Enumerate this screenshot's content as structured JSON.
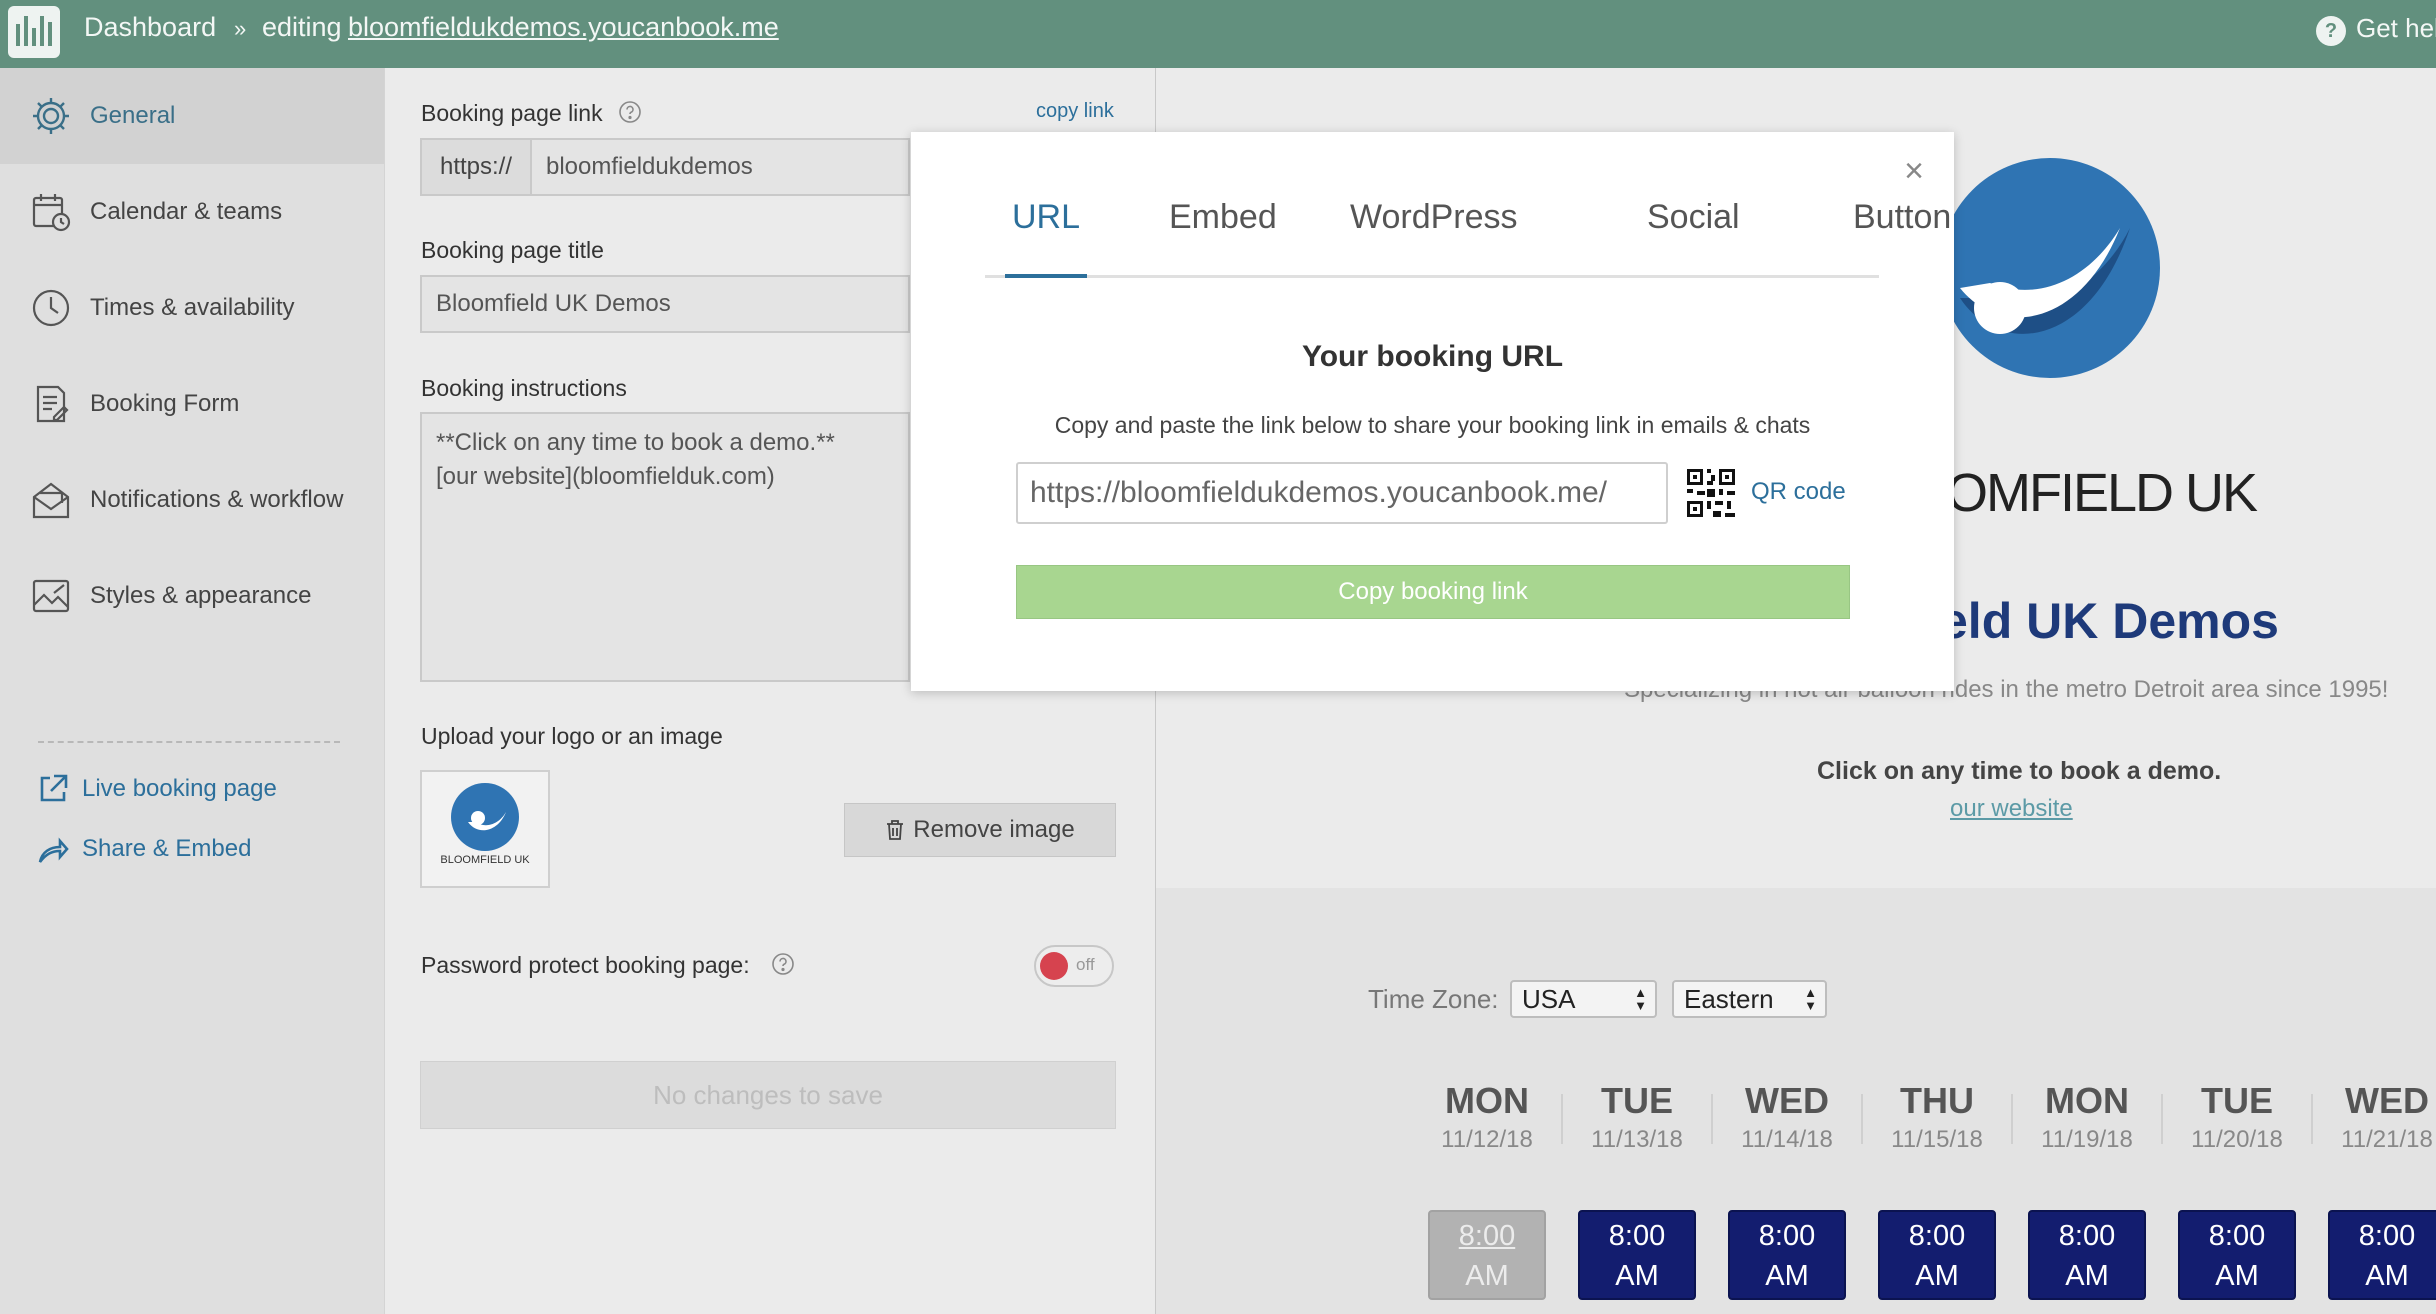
{
  "topbar": {
    "dashboard": "Dashboard",
    "separator": "»",
    "editing": "editing",
    "site_link": "bloomfieldukdemos.youcanbook.me",
    "help": "Get hel"
  },
  "sidebar": {
    "items": [
      {
        "label": "General",
        "icon": "gear-icon",
        "active": true
      },
      {
        "label": "Calendar & teams",
        "icon": "calendar-icon"
      },
      {
        "label": "Times & availability",
        "icon": "clock-icon"
      },
      {
        "label": "Booking Form",
        "icon": "form-icon"
      },
      {
        "label": "Notifications & workflow",
        "icon": "envelope-icon"
      },
      {
        "label": "Styles & appearance",
        "icon": "image-icon"
      }
    ],
    "links": [
      {
        "label": "Live booking page",
        "icon": "external-link-icon"
      },
      {
        "label": "Share & Embed",
        "icon": "share-icon"
      }
    ]
  },
  "form": {
    "booking_link_label": "Booking page link",
    "copy_link": "copy link",
    "prefix": "https://",
    "slug": "bloomfieldukdemos",
    "title_label": "Booking page title",
    "title_value": "Bloomfield UK Demos",
    "instructions_label": "Booking instructions",
    "instructions_line1": "**Click on any time to book a demo.**",
    "instructions_line2": "[our website](bloomfielduk.com)",
    "upload_label": "Upload your logo or an image",
    "logo_caption": "BLOOMFIELD UK",
    "remove_image": "Remove image",
    "password_label": "Password protect booking page:",
    "toggle_state": "off",
    "save_button": "No changes to save"
  },
  "modal": {
    "tabs": [
      "URL",
      "Embed",
      "WordPress",
      "Social",
      "Button"
    ],
    "active_tab": "URL",
    "heading": "Your booking URL",
    "description": "Copy and paste the link below to share your booking link in emails & chats",
    "url": "https://bloomfieldukdemos.youcanbook.me/",
    "qr_label": "QR code",
    "copy_button": "Copy booking link"
  },
  "preview": {
    "logo_text": "OMFIELD UK",
    "title": "eld UK Demos",
    "subtitle": "Specializing in hot air balloon rides in the metro Detroit area since 1995!",
    "click_text": "Click on any time to book a demo.",
    "website": "our website",
    "timezone_label": "Time Zone:",
    "timezone_country": "USA",
    "timezone_zone": "Eastern",
    "days": [
      {
        "name": "MON",
        "date": "11/12/18",
        "slot_time": "8:00",
        "slot_ampm": "AM",
        "available": false
      },
      {
        "name": "TUE",
        "date": "11/13/18",
        "slot_time": "8:00",
        "slot_ampm": "AM",
        "available": true
      },
      {
        "name": "WED",
        "date": "11/14/18",
        "slot_time": "8:00",
        "slot_ampm": "AM",
        "available": true
      },
      {
        "name": "THU",
        "date": "11/15/18",
        "slot_time": "8:00",
        "slot_ampm": "AM",
        "available": true
      },
      {
        "name": "MON",
        "date": "11/19/18",
        "slot_time": "8:00",
        "slot_ampm": "AM",
        "available": true
      },
      {
        "name": "TUE",
        "date": "11/20/18",
        "slot_time": "8:00",
        "slot_ampm": "AM",
        "available": true
      },
      {
        "name": "WED",
        "date": "11/21/18",
        "slot_time": "8:00",
        "slot_ampm": "AM",
        "available": true
      }
    ]
  },
  "colors": {
    "topbar": "#62907e",
    "link": "#2c6f9b",
    "slot": "#131d6f",
    "copy_button": "#a8d690",
    "toggle_off": "#d6434f"
  }
}
